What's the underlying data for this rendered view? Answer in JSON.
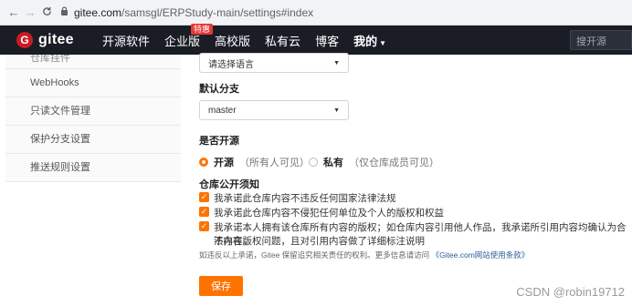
{
  "browser": {
    "back_icon": "←",
    "forward_icon": "→",
    "reload_icon": "C",
    "url_host": "gitee.com",
    "url_path": "/samsgl/ERPStudy-main/settings#index"
  },
  "header": {
    "logo_mark": "G",
    "logo_text": "gitee",
    "menu": [
      "开源软件",
      "企业版",
      "高校版",
      "私有云",
      "博客",
      "我的"
    ],
    "enterprise_badge": "特惠",
    "search_placeholder": "搜开源"
  },
  "sidebar": {
    "items": [
      "仓库挂件",
      "WebHooks",
      "只读文件管理",
      "保护分支设置",
      "推送规则设置"
    ]
  },
  "form": {
    "language_select": "请选择语言",
    "default_branch_label": "默认分支",
    "default_branch_value": "master",
    "open_source_label": "是否开源",
    "option_public": "开源",
    "option_public_hint": "（所有人可见）",
    "option_private": "私有",
    "option_private_hint": "（仅仓库成员可见）",
    "notice_title": "仓库公开须知",
    "checks": [
      "我承诺此仓库内容不违反任何国家法律法规",
      "我承诺此仓库内容不侵犯任何单位及个人的版权和权益",
      "我承诺本人拥有该仓库所有内容的版权；如仓库内容引用他人作品，我承诺所引用内容均确认为合法内容，",
      "不存在版权问题，且对引用内容做了详细标注说明"
    ],
    "notice_text": "如违反以上承诺，Gitee 保留追究相关责任的权利。更多信息请访问",
    "notice_link": "《Gitee.com网站使用条款》",
    "save_label": "保存",
    "accent": "#fe7300"
  },
  "watermark": "CSDN @robin19712"
}
